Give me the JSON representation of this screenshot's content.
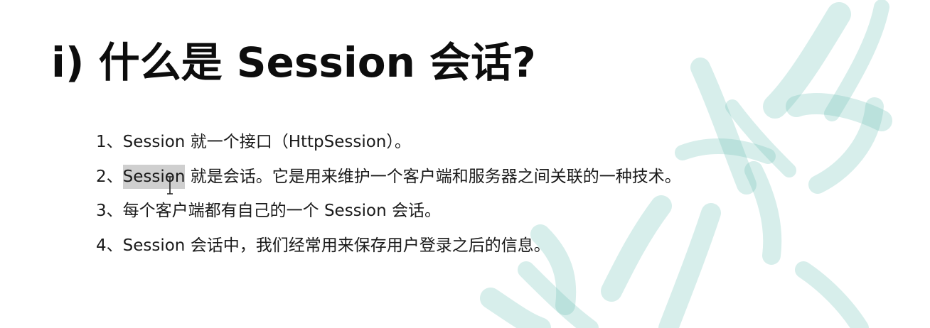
{
  "slide": {
    "title": "i) 什么是 Session 会话?",
    "items": [
      {
        "text": "1、Session 就一个接口（HttpSession）。"
      },
      {
        "highlight_prefix": "2、",
        "highlight_text": "Session",
        "rest": " 就是会话。它是用来维护一个客户端和服务器之间关联的一种技术。"
      },
      {
        "text": "3、每个客户端都有自己的一个 Session 会话。"
      },
      {
        "text": "4、Session 会话中，我们经常用来保存用户登录之后的信息。"
      }
    ]
  },
  "colors": {
    "watermark": "#6fc2b8",
    "selection": "#cfcfcf",
    "text": "#1a1a1a"
  },
  "icons": {
    "cursor": "text-cursor-icon"
  }
}
